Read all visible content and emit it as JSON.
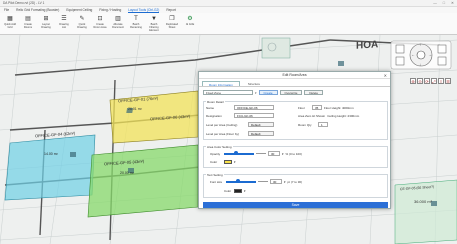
{
  "window": {
    "title": "DA Pilot Demo.rvt (2D) - LV 1",
    "controls": [
      "—",
      "□",
      "✕"
    ]
  },
  "menu": {
    "items": [
      "File",
      "Relic Grid Formating (Booster)",
      "Equipment Ceiling",
      "Fixing / Hosting",
      "Layout Tools (Ctrl-G2)",
      "Report"
    ],
    "active_index": 4
  },
  "ribbon": {
    "buttons": [
      {
        "label": "Quick Add Grid",
        "icon": "grid-icon"
      },
      {
        "label": "Create Rooms",
        "icon": "room-icon"
      },
      {
        "label": "Layout Drawing",
        "icon": "layout-icon"
      },
      {
        "label": "Drawing List",
        "icon": "list-icon"
      },
      {
        "label": "Quick Drawing",
        "icon": "pen-icon"
      },
      {
        "label": "Create Room Area",
        "icon": "area-icon"
      },
      {
        "label": "Allocate Document",
        "icon": "document-icon"
      },
      {
        "label": "Batch Renaming",
        "icon": "text-icon"
      },
      {
        "label": "Batch Filtering Element",
        "icon": "filter-icon"
      },
      {
        "label": "Duplicated Sheet",
        "icon": "copy-icon"
      },
      {
        "label": "AI ACE",
        "icon": "ai-icon"
      }
    ]
  },
  "canvas": {
    "rooms": [
      {
        "label": "OFFICE-GF-01 (76m²)",
        "sub": "26.01 m²"
      },
      {
        "label": "OFFICE-GF-06 (43m²)",
        "sub": "20.00 m²"
      },
      {
        "label": "OFFICE-GF-04 (62m²)",
        "sub": "14.00 m²"
      },
      {
        "label": "OFFICE-GF-05 (43m²)",
        "sub": "20.00 m²"
      },
      {
        "label": "HOA",
        "sub": ""
      },
      {
        "label": "CE-GF-05 (66 Sheet?)",
        "sub": "36.000 m²"
      }
    ]
  },
  "dialog": {
    "title": "Edit Room/Area",
    "close": "✕",
    "tabs": [
      "Room Information",
      "Structure"
    ],
    "selected_tab": 0,
    "type_select": "Fixed Zone",
    "type_buttons": [
      "Create",
      "Overwrite",
      "Delete"
    ],
    "room_detail_title": "Room Detail",
    "name_label": "Name",
    "name_value": "OFFICE-GF-06",
    "floor_label": "Floor",
    "floor_value": "35",
    "floor_height": "Floor Height: 4000mm",
    "designation_label": "Designation",
    "designation_value": "FCU-GF-06",
    "zero_state_label": "Area Zero Ht Shown",
    "ceiling_height": "Ceiling Height: 2300mm",
    "level_label_1": "Level per Area (Ceiling)",
    "level_value_1": "Default",
    "room_qty_label": "Room Qty",
    "room_qty_value": "1",
    "level_label_2": "Level per Area (Floor by)",
    "level_value_2": "Default",
    "area_color_title": "Area Color Setting",
    "opacity_label": "Opacity",
    "opacity_value": "30",
    "opacity_unit": "% (0 to 100)",
    "color_label": "Color",
    "text_setting_title": "Text Setting",
    "fontsize_label": "Font size",
    "fontsize_value": "30",
    "fontsize_unit": "pt (7 to 30)",
    "text_color_label": "Color",
    "ok_label": "Save",
    "colors": {
      "area_swatch": "#f7e14a",
      "text_swatch": "#222222",
      "primary": "#2b6fd6"
    }
  },
  "nav": {
    "arrows": [
      "↑",
      "↓",
      "←",
      "→"
    ],
    "tools": [
      "⊕",
      "⊖",
      "⟳",
      "⤢",
      "≡",
      "☰"
    ]
  }
}
